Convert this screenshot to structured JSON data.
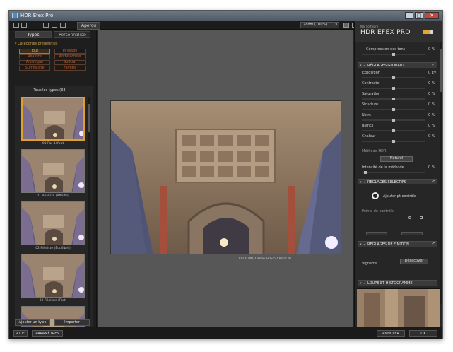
{
  "window": {
    "title": "HDR Efex Pro"
  },
  "topbar": {
    "preview_label": "Aperçu",
    "zoom_label": "Zoom (100%)"
  },
  "left_panel": {
    "tabs": [
      "Types",
      "Personnalisé"
    ],
    "categories_header": "Catégories prédéfinies",
    "categories": [
      {
        "label": "Tout",
        "active": true
      },
      {
        "label": "Paysage",
        "active": false
      },
      {
        "label": "Réaliste",
        "active": false
      },
      {
        "label": "Architecture",
        "active": false
      },
      {
        "label": "Artistique",
        "active": false
      },
      {
        "label": "Spécial",
        "active": false
      },
      {
        "label": "Surréaliste",
        "active": false
      },
      {
        "label": "Favoris",
        "active": false
      }
    ],
    "thumbnails_title": "Tous les types (33)",
    "thumbnails": [
      "01 Par défaut",
      "01 Réaliste (Affaibli)",
      "02 Réaliste (Équilibré)",
      "03 Réaliste (Fort)",
      ""
    ],
    "add_type_button": "Ajouter un type",
    "import_button": "Importer"
  },
  "center": {
    "caption": "(21.0 MP, Canon EOS 5D Mark II)"
  },
  "right_panel": {
    "brand_small": "Nik Software",
    "brand_big": "HDR EFEX PRO",
    "compression": {
      "label": "Compression des tons",
      "value": "0 %"
    },
    "sections": {
      "global": "RÉGLAGES GLOBAUX",
      "selective": "RÉGLAGES SÉLECTIFS",
      "finishing": "RÉGLAGES DE FINITION",
      "loupe": "LOUPE ET HISTOGRAMME"
    },
    "global_controls": [
      {
        "label": "Exposition",
        "value": "0 EV"
      },
      {
        "label": "Contraste",
        "value": "0 %"
      },
      {
        "label": "Saturation",
        "value": "0 %"
      },
      {
        "label": "Structure",
        "value": "0 %"
      },
      {
        "label": "Noirs",
        "value": "0 %"
      },
      {
        "label": "Blancs",
        "value": "0 %"
      },
      {
        "label": "Chaleur",
        "value": "0 %"
      }
    ],
    "method_label": "Méthode HDR",
    "method_value": "Naturel",
    "method_intensity": {
      "label": "Intensité de la méthode",
      "value": "0 %"
    },
    "add_control_point": "Ajouter pt contrôle",
    "control_points_label": "Points de contrôle",
    "vignette_label": "Vignette",
    "vignette_value": "Désactiver"
  },
  "bottombar": {
    "help": "AIDE",
    "settings": "PARAMÈTRES",
    "cancel": "ANNULER",
    "ok": "OK"
  },
  "colors": {
    "accent": "#e1a72e",
    "category_text": "#c65a36",
    "panel_bg": "#262626",
    "canvas_bg": "#575757"
  }
}
